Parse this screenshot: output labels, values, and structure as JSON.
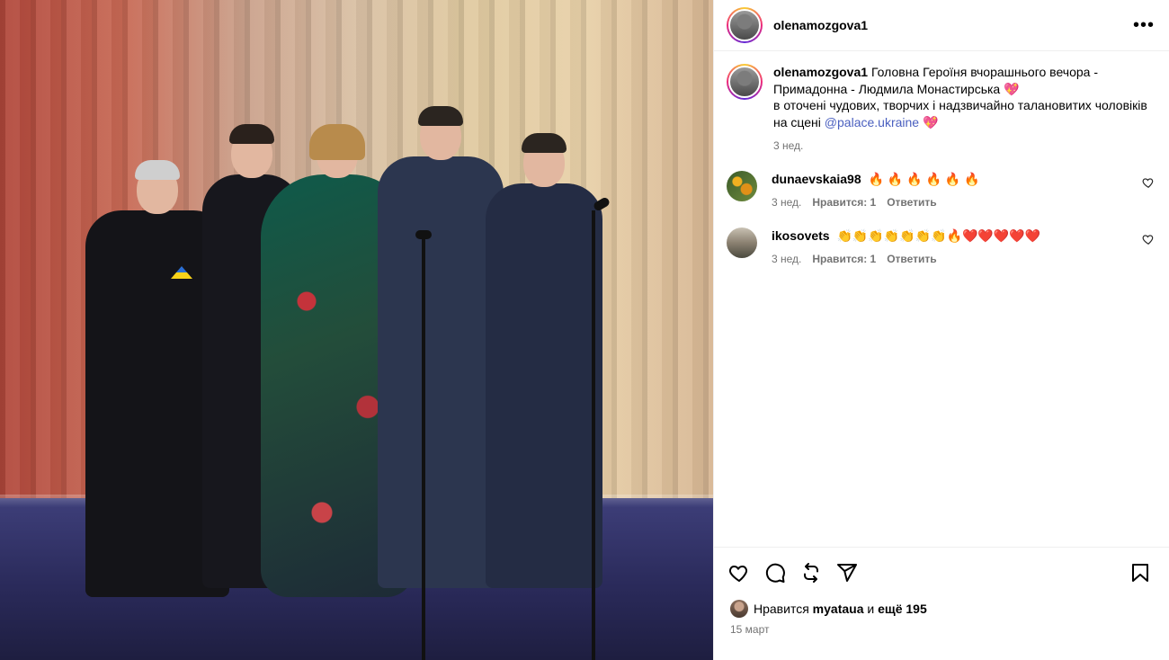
{
  "post": {
    "username": "olenamozgova1",
    "more_icon": "•••"
  },
  "caption": {
    "author": "olenamozgova1",
    "line1": "Головна Героїня вчорашнього вечора - Примадонна - Людмила Монастирська 💖",
    "line2": "в оточені чудових, творчих і надзвичайно талановитих чоловіків на сцені",
    "mention": "@palace.ukraine",
    "emoji_end": "💖",
    "time": "3 нед."
  },
  "comments": [
    {
      "author": "dunaevskaia98",
      "text": "🔥 🔥 🔥 🔥 🔥 🔥",
      "time": "3 нед.",
      "likes": "Нравится: 1",
      "reply": "Ответить"
    },
    {
      "author": "ikosovets",
      "text": "👏👏👏👏👏👏👏🔥❤️❤️❤️❤️❤️",
      "time": "3 нед.",
      "likes": "Нравится: 1",
      "reply": "Ответить"
    }
  ],
  "footer": {
    "likes_prefix": "Нравится",
    "likes_user": "myataua",
    "likes_mid": "и",
    "likes_count": "ещё 195",
    "date": "15 март"
  },
  "icons": {
    "like": "heart-icon",
    "comment": "comment-icon",
    "share": "repost-icon",
    "send": "send-icon",
    "save": "bookmark-icon"
  },
  "colors": {
    "mention": "#4a5fbf",
    "meta": "#737373",
    "border": "#efefef"
  }
}
